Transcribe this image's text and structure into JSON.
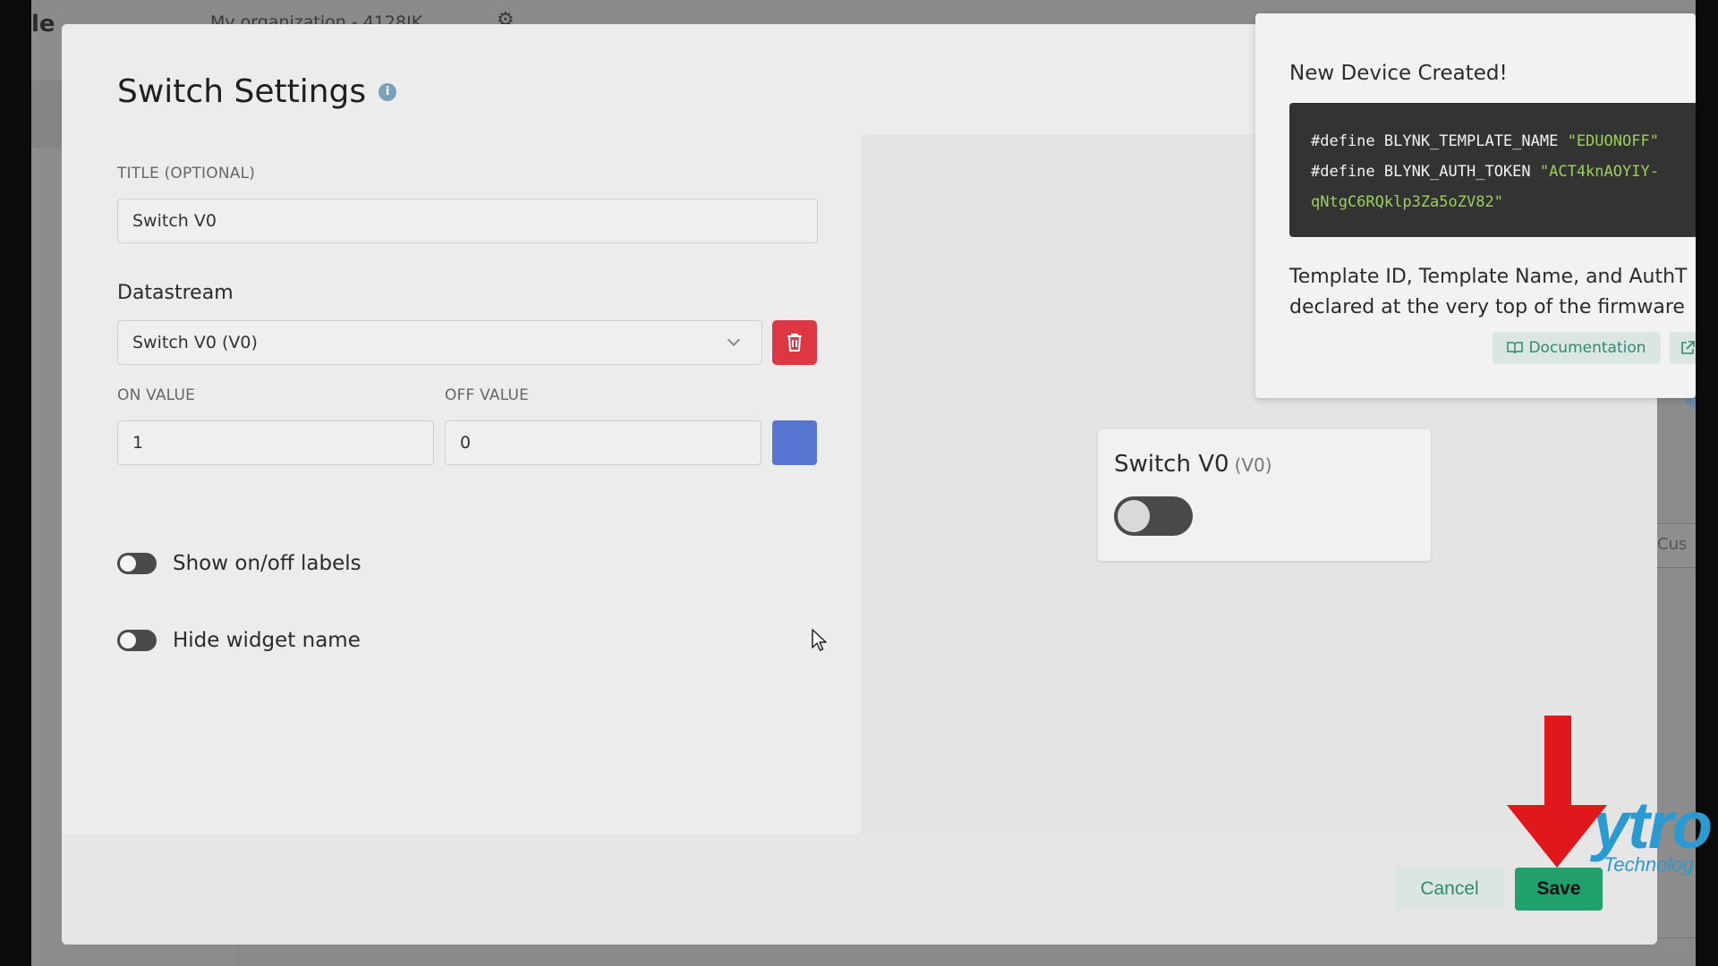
{
  "background": {
    "logo_fragment": "le",
    "org_text": "My organization - 4128IK",
    "right_button_text": "Cus"
  },
  "modal": {
    "title": "Switch Settings",
    "title_field": {
      "label": "TITLE (OPTIONAL)",
      "value": "Switch V0"
    },
    "datastream": {
      "label": "Datastream",
      "selected": "Switch V0 (V0)"
    },
    "on_value": {
      "label": "ON VALUE",
      "value": "1"
    },
    "off_value": {
      "label": "OFF VALUE",
      "value": "0"
    },
    "color": "#5676d2",
    "toggles": [
      {
        "label": "Show on/off labels",
        "on": false
      },
      {
        "label": "Hide widget name",
        "on": false
      }
    ],
    "preview": {
      "name": "Switch V0",
      "pin": "(V0)",
      "on": false
    },
    "buttons": {
      "cancel": "Cancel",
      "save": "Save"
    }
  },
  "notification": {
    "title": "New Device Created!",
    "code_lines": [
      {
        "prefix": "#define BLYNK_TEMPLATE_NAME ",
        "value": "\"EDUONOFF\""
      },
      {
        "prefix": "#define BLYNK_AUTH_TOKEN ",
        "value": "\"ACT4knAOYIY-"
      },
      {
        "prefix": "",
        "value": "qNtgC6RQklp3Za5oZV82\""
      }
    ],
    "description_lines": [
      "Template ID, Template Name, and AuthT",
      "declared at the very top of the firmware"
    ],
    "documentation_button": "Documentation"
  },
  "watermark": {
    "text": "ytro",
    "subtext": "Technolog"
  },
  "colors": {
    "accent_green": "#22a06b",
    "danger_red": "#dc3743",
    "annotation_red": "#e0171b"
  }
}
